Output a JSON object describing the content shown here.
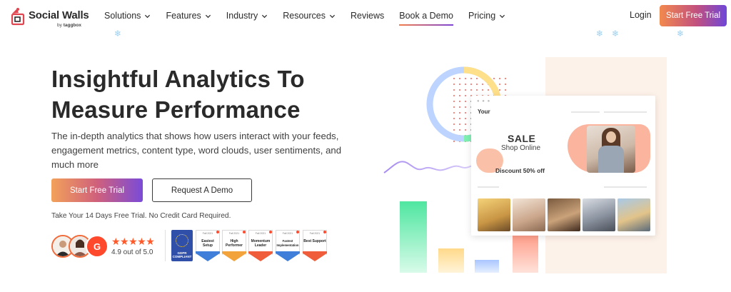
{
  "brand": {
    "name": "Social Walls",
    "sub_by": "by",
    "sub_name": "taggbox",
    "accent": "#e0464f"
  },
  "nav": {
    "items": [
      {
        "label": "Solutions",
        "has_dropdown": true
      },
      {
        "label": "Features",
        "has_dropdown": true
      },
      {
        "label": "Industry",
        "has_dropdown": true
      },
      {
        "label": "Resources",
        "has_dropdown": true
      },
      {
        "label": "Reviews",
        "has_dropdown": false
      },
      {
        "label": "Book a Demo",
        "has_dropdown": false,
        "active": true
      },
      {
        "label": "Pricing",
        "has_dropdown": true
      }
    ],
    "login": "Login",
    "cta": "Start Free Trial"
  },
  "hero": {
    "title_line1": "Insightful Analytics To",
    "title_line2": "Measure Performance",
    "description": "The in-depth analytics that shows how users interact with your feeds, engagement metrics, content type, word clouds, user sentiments, and much more",
    "primary_button": "Start Free Trial",
    "secondary_button": "Request A Demo",
    "note": "Take Your 14 Days Free Trial. No Credit Card Required."
  },
  "rating": {
    "stars": "★★★★★",
    "text": "4.9 out of 5.0",
    "g2_label": "G"
  },
  "badges": {
    "gdpr_label": "GDPR COMPLIANT",
    "items": [
      {
        "label": "Easiest Setup",
        "season": "Fall 2021",
        "stripe": "#3f7fd9"
      },
      {
        "label": "High Performer",
        "season": "Fall 2021",
        "stripe": "#f3a33c"
      },
      {
        "label": "Momentum Leader",
        "season": "Fall 2021",
        "stripe": "#ef5d3a"
      },
      {
        "label": "Fastest Implementation",
        "season": "Fall 2021",
        "stripe": "#3f7fd9"
      },
      {
        "label": "Best Support",
        "season": "Fall 2021",
        "stripe": "#ef5d3a"
      }
    ]
  },
  "mockup": {
    "heading": "Your",
    "sale": "SALE",
    "shop_online": "Shop Online",
    "discount": "Discount 50% off"
  }
}
